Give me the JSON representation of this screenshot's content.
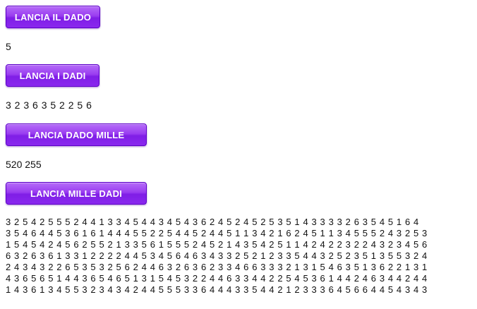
{
  "buttons": {
    "lancia_dado": "LANCIA IL DADO",
    "lancia_dadi": "LANCIA I DADI",
    "lancia_dado_mille": "LANCIA DADO MILLE",
    "lancia_mille_dadi": "LANCIA MILLE DADI"
  },
  "results": {
    "dado": "5",
    "dadi": "3 2 3 6 3 5 2 2 5 6",
    "dado_mille": "520 255"
  },
  "mille_dadi": {
    "lines": [
      "3 2 5 4 2 5 5 5 2 4 4 1 3 3 4 5 4 4 3 4 5 4 3 6 2 4 5 2 4 5 2 5 3 5 1 4 3 3 3 3 2 6 3 5 4 5 1 6 4",
      "3 5 4 6 4 4 5 3 6 1 6 1 4 4 4 5 5 2 2 5 4 4 5 2 4 4 5 1 1 3 4 2 1 6 2 4 5 1 1 3 4 5 5 5 2 4 3 2 5 3",
      "1 5 4 5 4 2 4 5 6 2 5 5 2 1 3 3 5 6 1 5 5 5 2 4 5 2 1 4 3 5 4 2 5 1 1 4 2 4 2 2 3 2 2 4 3 2 3 4 5 6",
      "6 3 2 6 3 6 1 3 3 1 2 2 2 2 4 4 5 3 4 5 6 4 6 3 4 3 3 2 5 2 1 2 3 3 5 4 4 3 2 5 2 3 5 1 3 5 5 3 2 4",
      "2 4 3 4 3 2 2 6 5 3 5 3 2 5 6 2 4 4 6 3 2 6 3 6 2 3 3 4 6 6 3 3 3 2 1 3 1 5 4 6 3 5 1 3 6 2 2 1 3 1",
      "4 3 6 5 6 5 1 4 4 3 6 5 4 6 5 1 3 1 5 4 5 3 2 2 4 4 6 3 3 4 4 2 2 5 4 5 3 6 1 4 4 2 4 6 3 4 4 2 4 4",
      "1 4 3 6 1 3 4 5 5 3 2 3 4 3 4 2 4 4 5 5 5 3 3 6 4 4 4 3 3 5 4 4 2 1 2 3 3 3 6 4 5 6 6 4 4 5 4 3 4 3"
    ]
  },
  "colors": {
    "button_purple": "#8a28ee",
    "button_text": "#ffffff",
    "text": "#111111"
  }
}
